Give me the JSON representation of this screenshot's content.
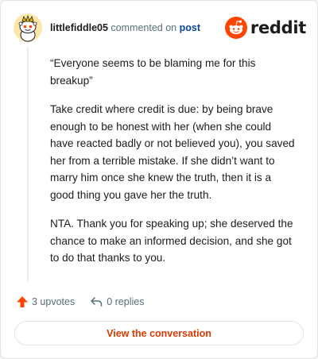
{
  "header": {
    "username": "littlefiddle05",
    "action": "commented on",
    "link": "post",
    "brand": "reddit"
  },
  "comment": {
    "paragraphs": [
      "“Everyone seems to be blaming me for this breakup”",
      "Take credit where credit is due: by being brave enough to be honest with her (when she could have reacted badly or not believed you), you saved her from a terrible mistake. If she didn’t want to marry him once she knew the truth, then it is a good thing you gave her the truth.",
      "NTA. Thank you for speaking up; she deserved the chance to make an informed decision, and she got to do that thanks to you."
    ]
  },
  "footer": {
    "upvotes": "3 upvotes",
    "replies": "0 replies"
  },
  "cta": {
    "label": "View the conversation"
  },
  "colors": {
    "brand_orange": "#ff4500",
    "link_blue": "#0a449b",
    "cta_text": "#d93900",
    "muted": "#576f76"
  },
  "icons": [
    "snoo-avatar-icon",
    "reddit-logo-icon",
    "upvote-arrow-icon",
    "reply-arrow-icon"
  ]
}
